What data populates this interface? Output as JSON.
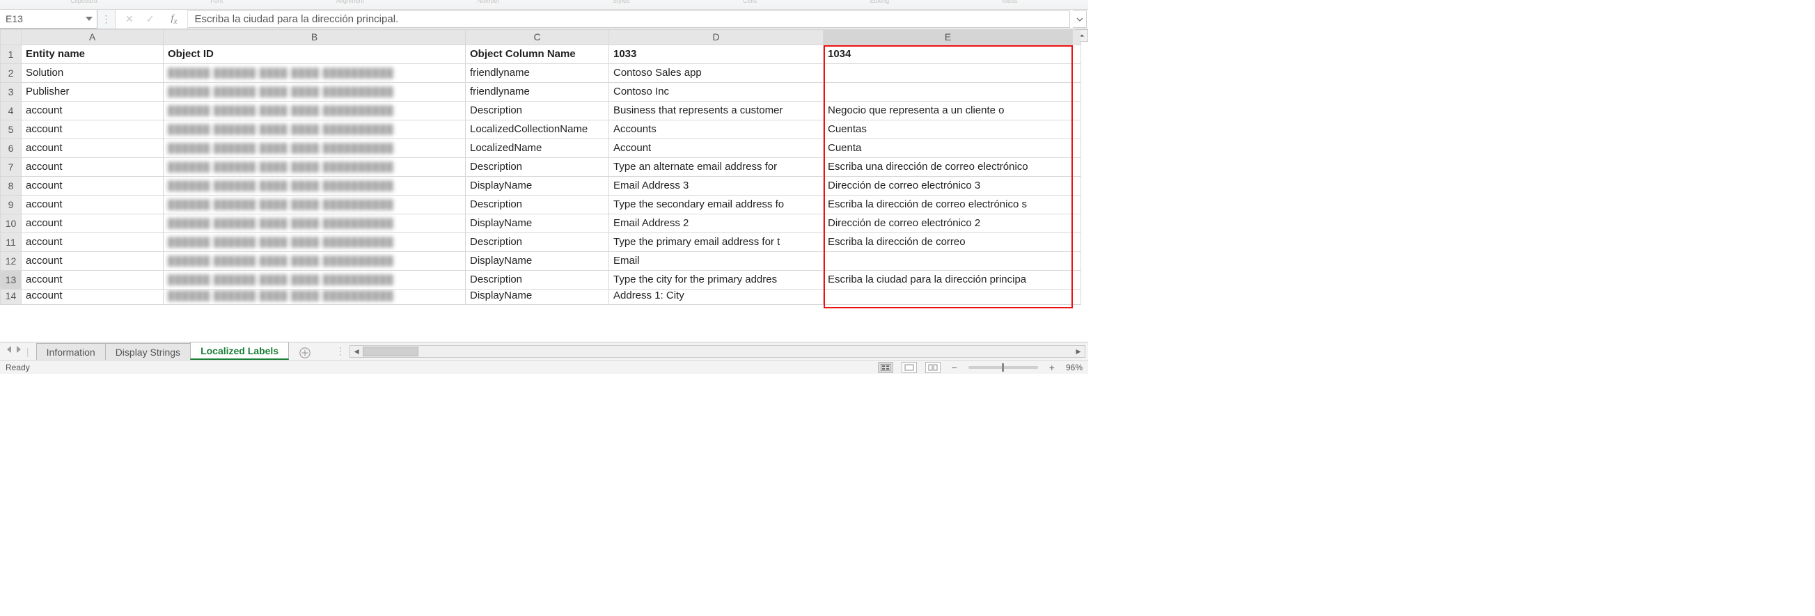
{
  "ribbonHints": [
    "Clipboard",
    "Font",
    "Alignment",
    "Number",
    "Styles",
    "Cells",
    "Editing",
    "Ideas"
  ],
  "nameBox": "E13",
  "formulaBar": "Escriba la ciudad para la dirección principal.",
  "activeCell": {
    "col": "E",
    "row": 13
  },
  "columns": [
    "A",
    "B",
    "C",
    "D",
    "E"
  ],
  "headers": {
    "A": "Entity name",
    "B": "Object ID",
    "C": "Object Column Name",
    "D": "1033",
    "E": "1034"
  },
  "rows": [
    {
      "n": 2,
      "A": "Solution",
      "C": "friendlyname",
      "D": "Contoso Sales app",
      "E": ""
    },
    {
      "n": 3,
      "A": "Publisher",
      "C": "friendlyname",
      "D": "Contoso Inc",
      "E": ""
    },
    {
      "n": 4,
      "A": "account",
      "C": "Description",
      "D": "Business that represents a customer",
      "E": "Negocio que representa a un cliente o"
    },
    {
      "n": 5,
      "A": "account",
      "C": "LocalizedCollectionName",
      "D": "Accounts",
      "E": "Cuentas"
    },
    {
      "n": 6,
      "A": "account",
      "C": "LocalizedName",
      "D": "Account",
      "E": "Cuenta"
    },
    {
      "n": 7,
      "A": "account",
      "C": "Description",
      "D": "Type an alternate email address for",
      "E": "Escriba una dirección de correo electrónico"
    },
    {
      "n": 8,
      "A": "account",
      "C": "DisplayName",
      "D": "Email Address 3",
      "E": "Dirección de correo electrónico 3"
    },
    {
      "n": 9,
      "A": "account",
      "C": "Description",
      "D": "Type the secondary email address fo",
      "E": "Escriba la dirección de correo electrónico s"
    },
    {
      "n": 10,
      "A": "account",
      "C": "DisplayName",
      "D": "Email Address 2",
      "E": "Dirección de correo electrónico 2"
    },
    {
      "n": 11,
      "A": "account",
      "C": "Description",
      "D": "Type the primary email address for t",
      "E": "Escriba la dirección de correo"
    },
    {
      "n": 12,
      "A": "account",
      "C": "DisplayName",
      "D": "Email",
      "E": ""
    },
    {
      "n": 13,
      "A": "account",
      "C": "Description",
      "D": "Type the city for the primary addres",
      "E": "Escriba la ciudad para la dirección principa"
    },
    {
      "n": 14,
      "A": "account",
      "C": "DisplayName",
      "D": "Address 1: City",
      "E": ""
    }
  ],
  "sheetTabs": [
    {
      "label": "Information",
      "active": false
    },
    {
      "label": "Display Strings",
      "active": false
    },
    {
      "label": "Localized Labels",
      "active": true
    }
  ],
  "statusText": "Ready",
  "zoomLabel": "96%"
}
